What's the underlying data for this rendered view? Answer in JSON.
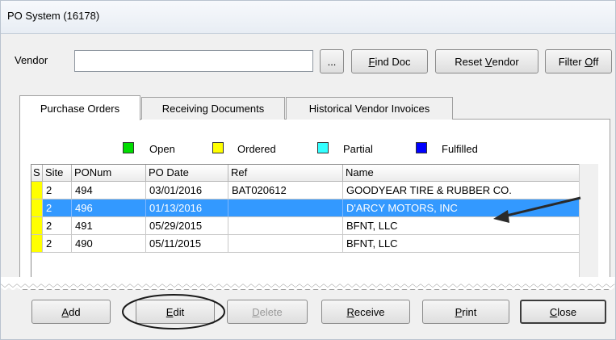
{
  "window": {
    "title": "PO System (16178)"
  },
  "vendor": {
    "label": "Vendor",
    "value": "",
    "browse_label": "..."
  },
  "toolbar": {
    "find_doc": {
      "pre": "",
      "key": "F",
      "post": "ind Doc"
    },
    "reset_vendor": {
      "pre": "Reset ",
      "key": "V",
      "post": "endor"
    },
    "filter_off": {
      "pre": "Filter ",
      "key": "O",
      "post": "ff"
    }
  },
  "tabs": [
    "Purchase Orders",
    "Receiving Documents",
    "Historical Vendor Invoices"
  ],
  "legend": [
    {
      "label": "Open",
      "color": "#00dd00"
    },
    {
      "label": "Ordered",
      "color": "#ffff00"
    },
    {
      "label": "Partial",
      "color": "#33ffff"
    },
    {
      "label": "Fulfilled",
      "color": "#0000ff"
    }
  ],
  "grid": {
    "columns": [
      "S",
      "Site",
      "PONum",
      "PO Date",
      "Ref",
      "Name"
    ],
    "rows": [
      {
        "status_color": "#ffff00",
        "site": "2",
        "ponum": "494",
        "po_date": "03/01/2016",
        "ref": "BAT020612",
        "name": "GOODYEAR TIRE & RUBBER CO.",
        "selected": false
      },
      {
        "status_color": "#ffff00",
        "site": "2",
        "ponum": "496",
        "po_date": "01/13/2016",
        "ref": "",
        "name": "D'ARCY MOTORS, INC",
        "selected": true
      },
      {
        "status_color": "#ffff00",
        "site": "2",
        "ponum": "491",
        "po_date": "05/29/2015",
        "ref": "",
        "name": "BFNT, LLC",
        "selected": false
      },
      {
        "status_color": "#ffff00",
        "site": "2",
        "ponum": "490",
        "po_date": "05/11/2015",
        "ref": "",
        "name": "BFNT, LLC",
        "selected": false
      }
    ]
  },
  "buttons": {
    "add": {
      "pre": "",
      "key": "A",
      "post": "dd"
    },
    "edit": {
      "pre": "",
      "key": "E",
      "post": "dit"
    },
    "delete": {
      "pre": "",
      "key": "D",
      "post": "elete"
    },
    "receive": {
      "pre": "",
      "key": "R",
      "post": "eceive"
    },
    "print": {
      "pre": "",
      "key": "P",
      "post": "rint"
    },
    "close": {
      "pre": "",
      "key": "C",
      "post": "lose"
    }
  }
}
